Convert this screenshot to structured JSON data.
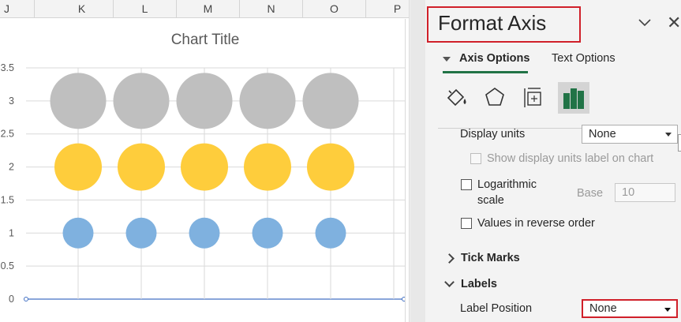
{
  "columns": [
    "J",
    "K",
    "L",
    "M",
    "N",
    "O",
    "P"
  ],
  "chart": {
    "title": "Chart Title",
    "ytick_labels": [
      "0",
      "0.5",
      "1",
      "1.5",
      "2",
      "2.5",
      "3",
      "3.5"
    ]
  },
  "chart_data": {
    "type": "scatter",
    "title": "Chart Title",
    "xlabel": "",
    "ylabel": "",
    "ylim": [
      0,
      3.5
    ],
    "xlim": [
      0,
      6
    ],
    "grid": true,
    "series": [
      {
        "color": "#7fb1df",
        "x": [
          1,
          2,
          3,
          4,
          5
        ],
        "y": [
          1,
          1,
          1,
          1,
          1
        ],
        "size": 1
      },
      {
        "color": "#fecd3c",
        "x": [
          1,
          2,
          3,
          4,
          5
        ],
        "y": [
          2,
          2,
          2,
          2,
          2
        ],
        "size": 2
      },
      {
        "color": "#bfbfbf",
        "x": [
          1,
          2,
          3,
          4,
          5
        ],
        "y": [
          3,
          3,
          3,
          3,
          3
        ],
        "size": 3
      }
    ]
  },
  "pane": {
    "title": "Format Axis",
    "tabs": {
      "axis_options": "Axis Options",
      "text_options": "Text Options"
    },
    "icons": [
      "fill-bucket-icon",
      "pentagon-icon",
      "size-properties-icon",
      "bar-chart-icon"
    ],
    "display_units": {
      "label": "Display units",
      "value": "None"
    },
    "show_units_label": "Show display units label on chart",
    "log_scale": {
      "label_line1": "Logarithmic",
      "label_line2": "scale",
      "base_label": "Base",
      "base_value": "10"
    },
    "reverse_order": "Values in reverse order",
    "tick_marks": "Tick Marks",
    "labels": "Labels",
    "label_position": {
      "label": "Label Position",
      "value": "None"
    },
    "accent_color": "#217346",
    "highlight_color": "#d0202a"
  }
}
